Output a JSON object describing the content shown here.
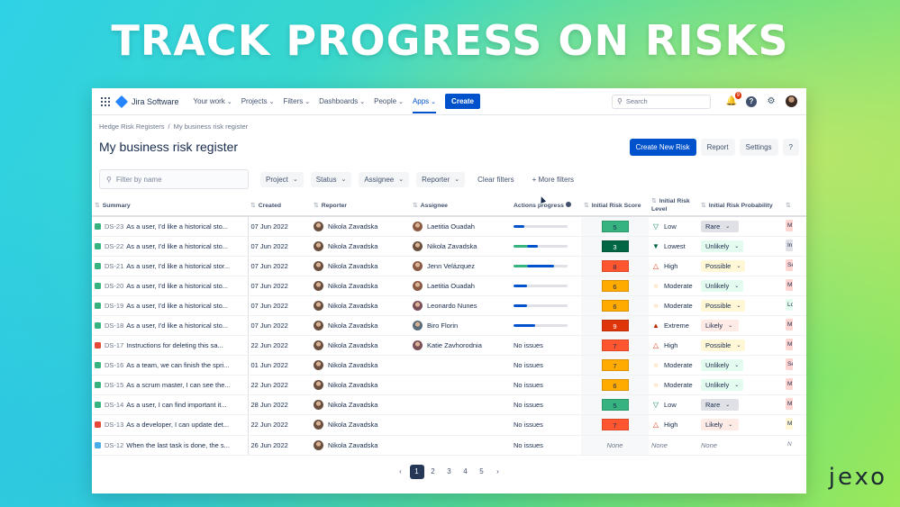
{
  "headline": "TRACK PROGRESS ON RISKS",
  "brand": "jexo",
  "nav": {
    "logo": "Jira Software",
    "items": [
      {
        "label": "Your work",
        "chevron": true
      },
      {
        "label": "Projects",
        "chevron": true
      },
      {
        "label": "Filters",
        "chevron": true
      },
      {
        "label": "Dashboards",
        "chevron": true
      },
      {
        "label": "People",
        "chevron": true
      },
      {
        "label": "Apps",
        "chevron": true,
        "active": true
      }
    ],
    "create_label": "Create",
    "search_placeholder": "Search",
    "notification_count": "9"
  },
  "breadcrumb": [
    "Hedge Risk Registers",
    "My business risk register"
  ],
  "page_title": "My business risk register",
  "actions": {
    "create_new_risk": "Create New Risk",
    "report": "Report",
    "settings": "Settings",
    "help": "?"
  },
  "filters": {
    "search_placeholder": "Filter by name",
    "buttons": [
      "Project",
      "Status",
      "Assignee",
      "Reporter"
    ],
    "clear": "Clear filters",
    "more": "+ More filters"
  },
  "columns": [
    "Summary",
    "Created",
    "Reporter",
    "Assignee",
    "Actions progress",
    "Initial Risk Score",
    "Initial Risk Level",
    "Initial Risk Probability"
  ],
  "colors": {
    "accent": "#0052cc",
    "green": "#36b37e",
    "red": "#ff5630",
    "orange": "#ffab00"
  },
  "rows": [
    {
      "type": "story",
      "key": "DS-23",
      "summary": "As a user, I'd like a historical sto...",
      "created": "07 Jun 2022",
      "reporter": "Nikola Zavadska",
      "assignee": "Laetitia Ouadah",
      "progress": {
        "kind": "bar",
        "done": 0.2,
        "green": 0
      },
      "score": "5",
      "score_color": "#36b37e",
      "level": "Low",
      "level_icon": "▽",
      "level_color": "#00875a",
      "prob": "Rare",
      "prob_bg": "#dfe1e6",
      "edge_bg": "#ffd5d2",
      "edge_text": "M"
    },
    {
      "type": "story",
      "key": "DS-22",
      "summary": "As a user, I'd like a historical sto...",
      "created": "07 Jun 2022",
      "reporter": "Nikola Zavadska",
      "assignee": "Nikola Zavadska",
      "progress": {
        "kind": "bar",
        "done": 0.25,
        "green": 0.25
      },
      "score": "3",
      "score_color": "#006644",
      "level": "Lowest",
      "level_icon": "▼",
      "level_color": "#006644",
      "prob": "Unlikely",
      "prob_bg": "#e3fcef",
      "edge_bg": "#dfe1e6",
      "edge_text": "In"
    },
    {
      "type": "story",
      "key": "DS-21",
      "summary": "As a user, I'd like a historical stor...",
      "created": "07 Jun 2022",
      "reporter": "Nikola Zavadska",
      "assignee": "Jenn Velázquez",
      "progress": {
        "kind": "bar",
        "done": 0.75,
        "green": 0.25
      },
      "score": "8",
      "score_color": "#ff5630",
      "level": "High",
      "level_icon": "△",
      "level_color": "#de350b",
      "prob": "Possible",
      "prob_bg": "#fff7d6",
      "edge_bg": "#ffd5d2",
      "edge_text": "Se"
    },
    {
      "type": "story",
      "key": "DS-20",
      "summary": "As a user, I'd like a historical sto...",
      "created": "07 Jun 2022",
      "reporter": "Nikola Zavadska",
      "assignee": "Laetitia Ouadah",
      "progress": {
        "kind": "bar",
        "done": 0.25,
        "green": 0
      },
      "score": "6",
      "score_color": "#ffab00",
      "level": "Moderate",
      "level_icon": "○",
      "level_color": "#ff991f",
      "prob": "Unlikely",
      "prob_bg": "#e3fcef",
      "edge_bg": "#ffd5d2",
      "edge_text": "M"
    },
    {
      "type": "story",
      "key": "DS-19",
      "summary": "As a user, I'd like a historical sto...",
      "created": "07 Jun 2022",
      "reporter": "Nikola Zavadska",
      "assignee": "Leonardo Nunes",
      "progress": {
        "kind": "bar",
        "done": 0.25,
        "green": 0
      },
      "score": "6",
      "score_color": "#ffab00",
      "level": "Moderate",
      "level_icon": "○",
      "level_color": "#ff991f",
      "prob": "Possible",
      "prob_bg": "#fff7d6",
      "edge_bg": "#e3fcef",
      "edge_text": "Lo"
    },
    {
      "type": "story",
      "key": "DS-18",
      "summary": "As a user, I'd like a historical sto...",
      "created": "07 Jun 2022",
      "reporter": "Nikola Zavadska",
      "assignee": "Biro Florin",
      "progress": {
        "kind": "bar",
        "done": 0.4,
        "green": 0
      },
      "score": "9",
      "score_color": "#de350b",
      "level": "Extreme",
      "level_icon": "▲",
      "level_color": "#bf2600",
      "prob": "Likely",
      "prob_bg": "#ffebe6",
      "edge_bg": "#ffd5d2",
      "edge_text": "M"
    },
    {
      "type": "bug",
      "key": "DS-17",
      "summary": "Instructions for deleting this sa...",
      "created": "22 Jun 2022",
      "reporter": "Nikola Zavadska",
      "assignee": "Katie Zavhorodnia",
      "progress": {
        "kind": "text",
        "text": "No issues"
      },
      "score": "7",
      "score_color": "#ff5630",
      "level": "High",
      "level_icon": "△",
      "level_color": "#de350b",
      "prob": "Possible",
      "prob_bg": "#fff7d6",
      "edge_bg": "#ffd5d2",
      "edge_text": "M"
    },
    {
      "type": "story",
      "key": "DS-16",
      "summary": "As a team, we can finish the spri...",
      "created": "01 Jun 2022",
      "reporter": "Nikola Zavadska",
      "assignee": "",
      "progress": {
        "kind": "text",
        "text": "No issues"
      },
      "score": "7",
      "score_color": "#ffab00",
      "level": "Moderate",
      "level_icon": "○",
      "level_color": "#ff991f",
      "prob": "Unlikely",
      "prob_bg": "#e3fcef",
      "edge_bg": "#ffd5d2",
      "edge_text": "Se"
    },
    {
      "type": "story",
      "key": "DS-15",
      "summary": "As a scrum master, I can see the...",
      "created": "22 Jun 2022",
      "reporter": "Nikola Zavadska",
      "assignee": "",
      "progress": {
        "kind": "text",
        "text": "No issues"
      },
      "score": "6",
      "score_color": "#ffab00",
      "level": "Moderate",
      "level_icon": "○",
      "level_color": "#ff991f",
      "prob": "Unlikely",
      "prob_bg": "#e3fcef",
      "edge_bg": "#ffd5d2",
      "edge_text": "M"
    },
    {
      "type": "story",
      "key": "DS-14",
      "summary": "As a user, I can find important it...",
      "created": "28 Jun 2022",
      "reporter": "Nikola Zavadska",
      "assignee": "",
      "progress": {
        "kind": "text",
        "text": "No issues"
      },
      "score": "5",
      "score_color": "#36b37e",
      "level": "Low",
      "level_icon": "▽",
      "level_color": "#00875a",
      "prob": "Rare",
      "prob_bg": "#dfe1e6",
      "edge_bg": "#ffd5d2",
      "edge_text": "M"
    },
    {
      "type": "bug",
      "key": "DS-13",
      "summary": "As a developer, I can update det...",
      "created": "22 Jun 2022",
      "reporter": "Nikola Zavadska",
      "assignee": "",
      "progress": {
        "kind": "text",
        "text": "No issues"
      },
      "score": "7",
      "score_color": "#ff5630",
      "level": "High",
      "level_icon": "△",
      "level_color": "#de350b",
      "prob": "Likely",
      "prob_bg": "#ffebe6",
      "edge_bg": "#fff7d6",
      "edge_text": "M"
    },
    {
      "type": "task",
      "key": "DS-12",
      "summary": "When the last task is done, the s...",
      "created": "26 Jun 2022",
      "reporter": "Nikola Zavadska",
      "assignee": "",
      "progress": {
        "kind": "text",
        "text": "No issues"
      },
      "score": "None",
      "score_color": "",
      "level": "None",
      "level_icon": "",
      "level_color": "",
      "prob": "None",
      "prob_bg": "",
      "edge_bg": "",
      "edge_text": "N"
    }
  ],
  "pagination": {
    "prev": "‹",
    "pages": [
      "1",
      "2",
      "3",
      "4",
      "5"
    ],
    "current": "1",
    "next": "›"
  }
}
